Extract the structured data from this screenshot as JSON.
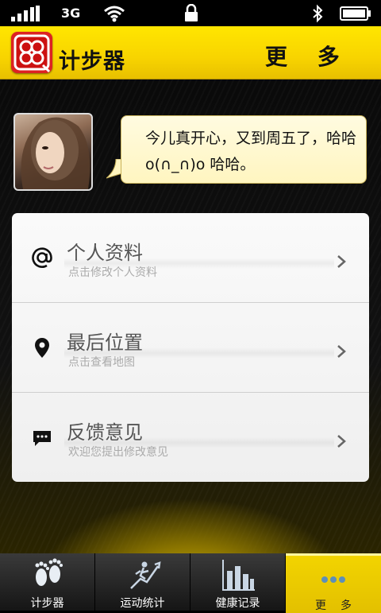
{
  "status_bar": {
    "network": "3G",
    "icons": [
      "signal-icon",
      "wifi-icon",
      "lock-icon",
      "bluetooth-icon",
      "battery-icon"
    ]
  },
  "header": {
    "app_name": "计步器",
    "page_title": "更 多",
    "accent_color": "#f8d400"
  },
  "profile": {
    "status_message": "今儿真开心，又到周五了，哈哈o(∩_∩)o 哈哈。"
  },
  "menu": [
    {
      "title": "个人资料",
      "subtitle": "点击修改个人资料",
      "icon": "at-icon"
    },
    {
      "title": "最后位置",
      "subtitle": "点击查看地图",
      "icon": "location-pin-icon"
    },
    {
      "title": "反馈意见",
      "subtitle": "欢迎您提出修改意见",
      "icon": "chat-bubble-icon"
    }
  ],
  "tabs": [
    {
      "label": "计步器",
      "icon": "footprints-icon"
    },
    {
      "label": "运动统计",
      "icon": "runner-stats-icon"
    },
    {
      "label": "健康记录",
      "icon": "bar-chart-icon"
    },
    {
      "label": "更多",
      "icon": "more-dots-icon",
      "active": true
    }
  ]
}
